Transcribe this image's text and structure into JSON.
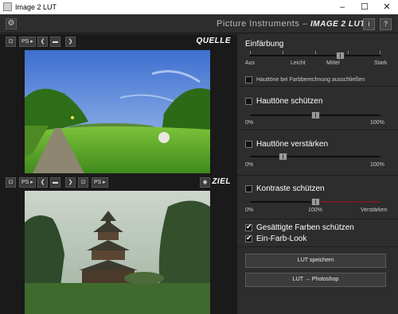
{
  "window": {
    "title": "Image 2 LUT",
    "controls": [
      "–",
      "☐",
      "✕"
    ]
  },
  "header": {
    "brand_light": "Picture Instruments",
    "brand_sep": " – ",
    "brand_bold": "IMAGE 2 LUT",
    "info_btn": "i",
    "help_btn": "?"
  },
  "source": {
    "label": "QUELLE",
    "toolbar": [
      "⊡",
      "PS ▸",
      "❮",
      "▬",
      "❯"
    ]
  },
  "target": {
    "label": "ZIEL",
    "toolbar": [
      "⊡",
      "PS ▸",
      "❮",
      "▬",
      "❯",
      "⊡",
      "PS ▸"
    ]
  },
  "panel": {
    "coloring": {
      "title": "Einfärbung",
      "labels": [
        "Aus",
        "Leicht",
        "Mittel",
        "Stark"
      ],
      "value_fraction": 0.69,
      "skin_check_label": "Hauttöne bei Farbberechnung ausschließen",
      "skin_check": false
    },
    "protect_skin": {
      "title": "Hauttöne schützen",
      "checked": false,
      "min": "0%",
      "max": "100%",
      "value_fraction": 0.5
    },
    "boost_skin": {
      "title": "Hauttöne verstärken",
      "checked": false,
      "min": "0%",
      "max": "100%",
      "value_fraction": 0.25
    },
    "protect_contrast": {
      "title": "Kontraste schützen",
      "checked": false,
      "min": "0%",
      "mid": "100%",
      "max": "Verstärken",
      "value_fraction": 0.5
    },
    "saturated": {
      "title": "Gesättigte Farben schützen",
      "checked": true
    },
    "mono": {
      "title": "Ein-Farb-Look",
      "checked": true
    },
    "save_lut": "LUT speichern",
    "to_photoshop": "LUT → Photoshop"
  }
}
